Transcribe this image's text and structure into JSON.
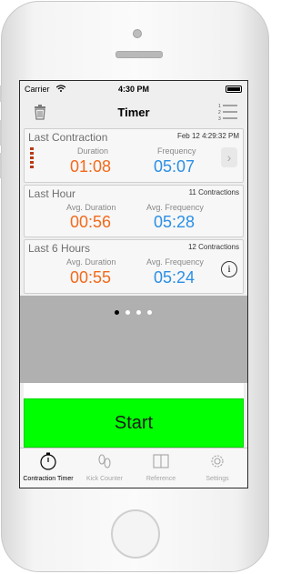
{
  "status_bar": {
    "carrier": "Carrier",
    "time": "4:30 PM"
  },
  "nav": {
    "title": "Timer",
    "left_icon": "trash-icon",
    "right_icon": "list-icon"
  },
  "cards": {
    "last_contraction": {
      "title": "Last Contraction",
      "meta": "Feb 12 4:29:32 PM",
      "duration_label": "Duration",
      "duration": "01:08",
      "frequency_label": "Frequency",
      "frequency": "05:07"
    },
    "last_hour": {
      "title": "Last Hour",
      "meta": "11 Contractions",
      "duration_label": "Avg. Duration",
      "duration": "00:56",
      "frequency_label": "Avg. Frequency",
      "frequency": "05:28"
    },
    "last_6_hours": {
      "title": "Last 6 Hours",
      "meta": "12 Contractions",
      "duration_label": "Avg. Duration",
      "duration": "00:55",
      "frequency_label": "Avg. Frequency",
      "frequency": "05:24"
    }
  },
  "pager": {
    "pages": 4,
    "current": 1
  },
  "start_button": {
    "label": "Start",
    "color": "#00ff00"
  },
  "tabs": [
    {
      "label": "Contraction Timer",
      "icon": "stopwatch-icon",
      "active": true
    },
    {
      "label": "Kick Counter",
      "icon": "footprints-icon",
      "active": false
    },
    {
      "label": "Reference",
      "icon": "book-icon",
      "active": false
    },
    {
      "label": "Settings",
      "icon": "gear-icon",
      "active": false
    }
  ],
  "colors": {
    "duration": "#f26a1b",
    "frequency": "#2b8fe6",
    "accent_stripes": "#b83a17"
  }
}
